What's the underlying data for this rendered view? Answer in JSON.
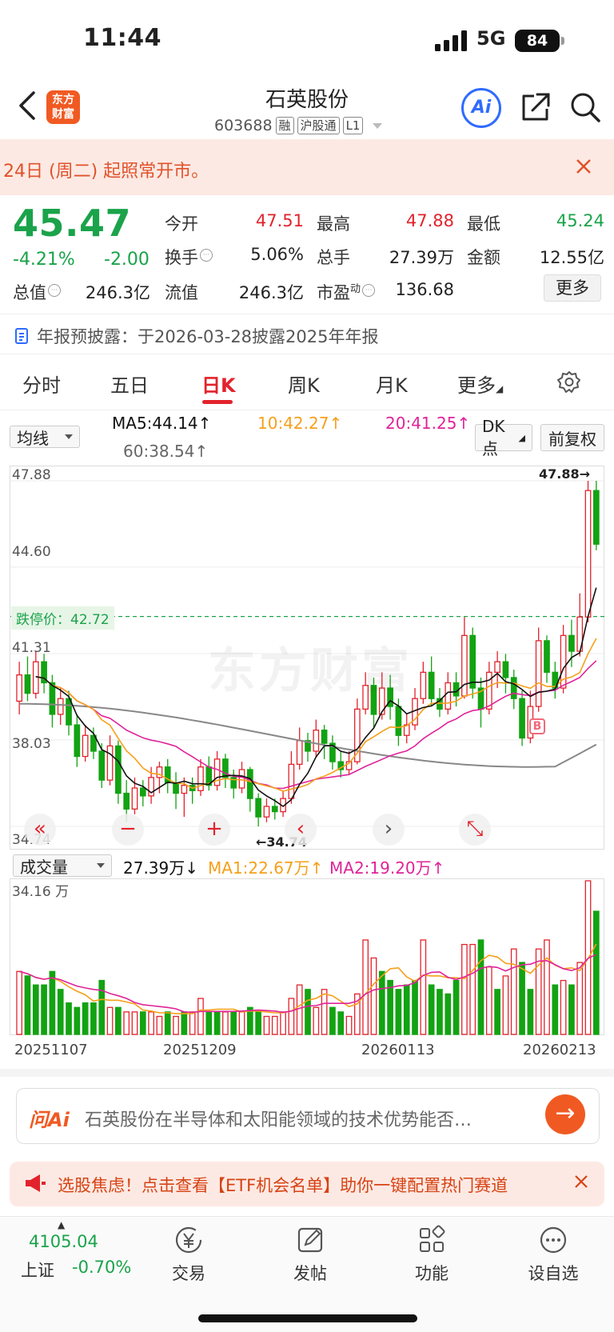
{
  "status": {
    "time": "11:44",
    "network": "5G",
    "battery": "84"
  },
  "header": {
    "logo_line1": "东方",
    "logo_line2": "财富",
    "title": "石英股份",
    "code": "603688",
    "tags": [
      "融",
      "沪股通",
      "L1"
    ],
    "ai_label": "Ai"
  },
  "notice": {
    "text": "24日 (周二) 起照常开市。"
  },
  "quote": {
    "price": "45.47",
    "change_pct": "-4.21%",
    "change": "-2.00",
    "open_label": "今开",
    "open": "47.51",
    "high_label": "最高",
    "high": "47.88",
    "low_label": "最低",
    "low": "45.24",
    "turnover_label": "换手",
    "turnover": "5.06%",
    "volume_label": "总手",
    "volume": "27.39万",
    "amount_label": "金额",
    "amount": "12.55亿",
    "mktcap_label": "总值",
    "mktcap": "246.3亿",
    "float_label": "流值",
    "float": "246.3亿",
    "pe_label": "市盈",
    "pe_sup": "动",
    "pe": "136.68",
    "more": "更多"
  },
  "announcement": {
    "text": "年报预披露：于2026-03-28披露2025年年报"
  },
  "tabs": [
    "分时",
    "五日",
    "日K",
    "周K",
    "月K",
    "更多"
  ],
  "ma": {
    "select": "均线",
    "ma5": "MA5:44.14↑",
    "ma10": "10:42.27↑",
    "ma20": "20:41.25↑",
    "ma60": "60:38.54↑",
    "dk": "DK点",
    "fq": "前复权"
  },
  "chart": {
    "y_labels": [
      "47.88",
      "44.60",
      "41.31",
      "38.03",
      "34.74"
    ],
    "limit_down": "跌停价：42.72",
    "high_mark": "47.88→",
    "low_mark": "←34.74",
    "watermark": "东方财富",
    "b_mark": "B",
    "ctrl": [
      "«",
      "−",
      "+",
      "‹",
      "›",
      "⤡"
    ]
  },
  "volume": {
    "select": "成交量",
    "vol": "27.39万↓",
    "ma1": "MA1:22.67万↑",
    "ma2": "MA2:19.20万↑",
    "max": "34.16 万"
  },
  "dates": [
    "20251107",
    "20251209",
    "20260113",
    "20260213"
  ],
  "colors": {
    "up": "#e2232c",
    "down": "#12a312",
    "ma5": "#111111",
    "ma10": "#f5a01a",
    "ma20": "#e0239a",
    "ma60": "#888888",
    "accent": "#f05a22"
  },
  "chart_data": {
    "type": "candlestick",
    "ylim": [
      34.74,
      47.88
    ],
    "candles": [
      [
        39.5,
        40.5,
        41.0,
        39.0
      ],
      [
        40.5,
        39.8,
        41.2,
        39.5
      ],
      [
        39.8,
        41.0,
        41.4,
        39.6
      ],
      [
        41.0,
        40.2,
        41.3,
        39.8
      ],
      [
        40.2,
        39.0,
        40.5,
        38.5
      ],
      [
        39.0,
        39.6,
        40.0,
        38.6
      ],
      [
        39.6,
        38.6,
        39.9,
        38.2
      ],
      [
        38.6,
        37.4,
        39.0,
        37.0
      ],
      [
        37.4,
        38.2,
        38.6,
        37.2
      ],
      [
        38.2,
        37.6,
        38.5,
        37.3
      ],
      [
        37.6,
        36.5,
        37.9,
        36.2
      ],
      [
        36.5,
        37.8,
        38.2,
        36.3
      ],
      [
        37.8,
        36.0,
        38.0,
        35.6
      ],
      [
        36.0,
        35.4,
        36.5,
        34.9
      ],
      [
        35.4,
        36.2,
        36.6,
        35.2
      ],
      [
        36.2,
        35.9,
        36.5,
        35.5
      ],
      [
        35.9,
        36.6,
        37.0,
        35.6
      ],
      [
        36.6,
        37.0,
        37.2,
        36.0
      ],
      [
        37.0,
        36.4,
        37.3,
        36.0
      ],
      [
        36.4,
        36.0,
        36.8,
        35.4
      ],
      [
        36.0,
        36.3,
        36.6,
        35.1
      ],
      [
        36.3,
        36.1,
        36.6,
        35.6
      ],
      [
        36.1,
        37.0,
        37.3,
        35.9
      ],
      [
        37.0,
        36.3,
        37.4,
        36.1
      ],
      [
        36.3,
        37.3,
        37.6,
        36.1
      ],
      [
        37.3,
        36.6,
        37.5,
        36.2
      ],
      [
        36.6,
        36.2,
        36.9,
        35.8
      ],
      [
        36.2,
        36.9,
        37.2,
        36.0
      ],
      [
        36.9,
        35.8,
        37.0,
        35.3
      ],
      [
        35.8,
        35.1,
        36.0,
        34.74
      ],
      [
        35.1,
        35.5,
        35.8,
        34.9
      ],
      [
        35.5,
        35.3,
        35.8,
        35.0
      ],
      [
        35.3,
        35.8,
        36.1,
        35.1
      ],
      [
        35.8,
        37.1,
        37.6,
        35.6
      ],
      [
        37.1,
        38.0,
        38.5,
        36.9
      ],
      [
        38.0,
        37.6,
        38.3,
        37.2
      ],
      [
        37.6,
        38.4,
        38.8,
        37.4
      ],
      [
        38.4,
        37.9,
        38.6,
        37.3
      ],
      [
        37.9,
        37.2,
        38.2,
        36.9
      ],
      [
        37.2,
        36.9,
        37.6,
        36.6
      ],
      [
        36.9,
        37.2,
        37.6,
        36.7
      ],
      [
        37.2,
        39.2,
        39.6,
        37.1
      ],
      [
        39.2,
        40.1,
        40.6,
        39.0
      ],
      [
        40.1,
        39.0,
        40.4,
        38.5
      ],
      [
        39.0,
        40.0,
        40.6,
        38.8
      ],
      [
        40.0,
        39.3,
        40.5,
        38.8
      ],
      [
        39.3,
        38.2,
        39.6,
        37.8
      ],
      [
        38.2,
        38.6,
        39.0,
        37.9
      ],
      [
        38.6,
        39.6,
        40.0,
        38.4
      ],
      [
        39.6,
        40.6,
        41.0,
        39.4
      ],
      [
        40.6,
        39.6,
        41.2,
        39.3
      ],
      [
        39.6,
        39.2,
        40.0,
        38.9
      ],
      [
        39.2,
        40.2,
        40.6,
        39.0
      ],
      [
        40.2,
        39.7,
        40.6,
        39.3
      ],
      [
        39.7,
        42.0,
        42.7,
        39.6
      ],
      [
        42.0,
        40.0,
        42.3,
        39.6
      ],
      [
        40.0,
        39.2,
        40.4,
        38.5
      ],
      [
        39.2,
        40.6,
        41.0,
        39.0
      ],
      [
        40.6,
        41.0,
        41.4,
        40.0
      ],
      [
        41.0,
        40.4,
        41.3,
        39.8
      ],
      [
        40.4,
        39.6,
        40.7,
        39.2
      ],
      [
        39.6,
        38.1,
        39.9,
        37.8
      ],
      [
        38.1,
        39.3,
        39.9,
        37.9
      ],
      [
        39.3,
        41.8,
        42.3,
        39.1
      ],
      [
        41.8,
        40.6,
        42.0,
        40.2
      ],
      [
        40.6,
        40.0,
        41.0,
        39.6
      ],
      [
        40.0,
        42.0,
        42.4,
        39.8
      ],
      [
        42.0,
        41.4,
        42.6,
        40.8
      ],
      [
        41.4,
        42.7,
        43.6,
        41.2
      ],
      [
        42.7,
        47.51,
        47.88,
        42.5
      ],
      [
        47.51,
        45.47,
        47.88,
        45.24
      ]
    ],
    "ma5_end": 44.14,
    "ma10_end": 42.27,
    "ma20_end": 41.25,
    "ma60_end": 38.54,
    "volumes": [
      [
        14,
        0
      ],
      [
        13,
        1
      ],
      [
        11,
        1
      ],
      [
        11,
        1
      ],
      [
        14,
        1
      ],
      [
        10,
        1
      ],
      [
        7,
        1
      ],
      [
        6,
        1
      ],
      [
        7,
        1
      ],
      [
        7,
        1
      ],
      [
        12,
        1
      ],
      [
        6,
        0
      ],
      [
        6,
        1
      ],
      [
        5,
        0
      ],
      [
        5,
        0
      ],
      [
        5,
        1
      ],
      [
        5,
        0
      ],
      [
        4,
        0
      ],
      [
        5,
        1
      ],
      [
        4,
        0
      ],
      [
        5,
        1
      ],
      [
        5,
        0
      ],
      [
        8,
        0
      ],
      [
        5,
        1
      ],
      [
        5,
        1
      ],
      [
        5,
        0
      ],
      [
        5,
        1
      ],
      [
        5,
        0
      ],
      [
        6,
        1
      ],
      [
        5,
        1
      ],
      [
        4,
        0
      ],
      [
        4,
        0
      ],
      [
        5,
        0
      ],
      [
        8,
        0
      ],
      [
        11,
        0
      ],
      [
        10,
        1
      ],
      [
        6,
        0
      ],
      [
        10,
        0
      ],
      [
        6,
        1
      ],
      [
        5,
        1
      ],
      [
        4,
        0
      ],
      [
        9,
        0
      ],
      [
        21,
        0
      ],
      [
        17,
        0
      ],
      [
        14,
        1
      ],
      [
        12,
        1
      ],
      [
        10,
        1
      ],
      [
        11,
        1
      ],
      [
        12,
        1
      ],
      [
        21,
        0
      ],
      [
        11,
        1
      ],
      [
        10,
        1
      ],
      [
        9,
        1
      ],
      [
        12,
        1
      ],
      [
        20,
        0
      ],
      [
        20,
        0
      ],
      [
        21,
        1
      ],
      [
        15,
        0
      ],
      [
        10,
        1
      ],
      [
        13,
        0
      ],
      [
        19,
        0
      ],
      [
        16,
        1
      ],
      [
        10,
        1
      ],
      [
        19,
        0
      ],
      [
        21,
        0
      ],
      [
        11,
        1
      ],
      [
        12,
        0
      ],
      [
        11,
        1
      ],
      [
        16,
        0
      ],
      [
        34.16,
        0
      ],
      [
        27.39,
        1
      ]
    ]
  }
}
